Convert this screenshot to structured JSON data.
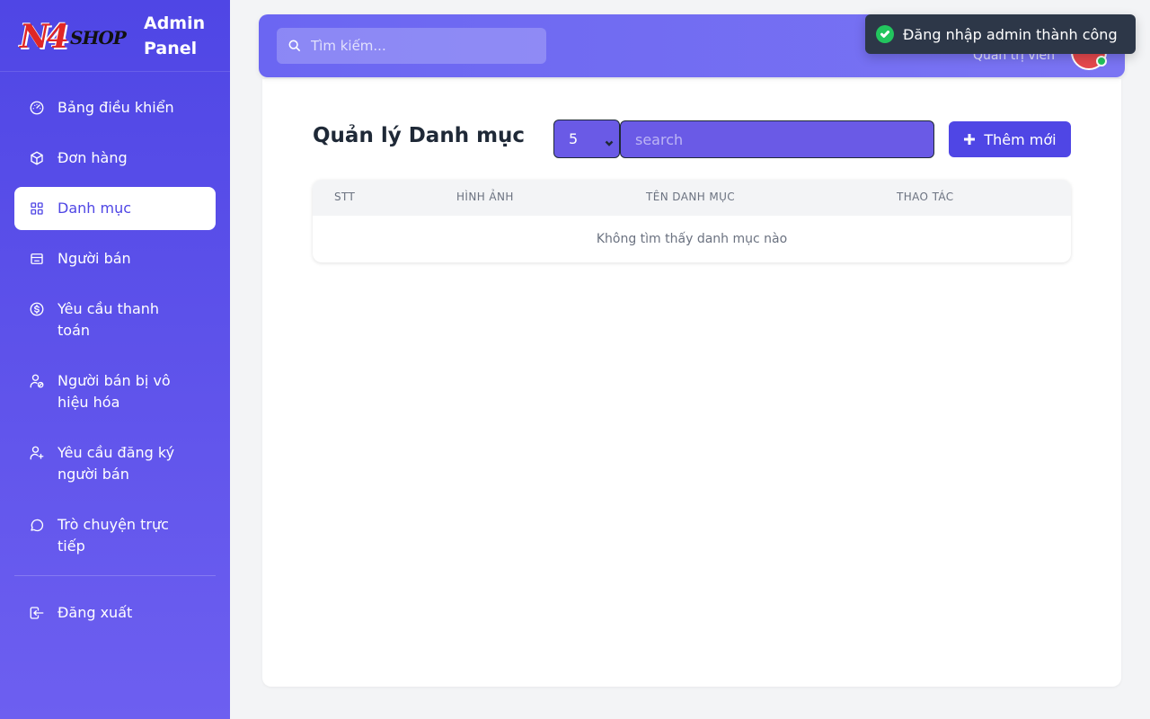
{
  "brand": {
    "logo_main": "N4",
    "logo_sub": "SHOP",
    "title": "Admin Panel"
  },
  "sidebar": {
    "items": [
      {
        "label": "Bảng điều khiển",
        "icon": "gauge-icon"
      },
      {
        "label": "Đơn hàng",
        "icon": "box-icon"
      },
      {
        "label": "Danh mục",
        "icon": "grid-icon",
        "active": true
      },
      {
        "label": "Người bán",
        "icon": "store-icon"
      },
      {
        "label": "Yêu cầu thanh toán",
        "icon": "dollar-icon"
      },
      {
        "label": "Người bán bị vô hiệu hóa",
        "icon": "user-block-icon"
      },
      {
        "label": "Yêu cầu đăng ký người bán",
        "icon": "user-plus-icon"
      },
      {
        "label": "Trò chuyện trực tiếp",
        "icon": "chat-icon"
      }
    ],
    "logout": {
      "label": "Đăng xuất",
      "icon": "logout-icon"
    }
  },
  "header": {
    "search_placeholder": "Tìm kiếm...",
    "role": "Quản trị viên"
  },
  "toast": {
    "message": "Đăng nhập admin thành công"
  },
  "main": {
    "title": "Quản lý Danh mục",
    "per_page": "5",
    "filter_placeholder": "search",
    "add_label": "Thêm mới",
    "columns": [
      "STT",
      "HÌNH ẢNH",
      "TÊN DANH MỤC",
      "THAO TÁC"
    ],
    "empty_message": "Không tìm thấy danh mục nào"
  },
  "colors": {
    "primary": "#4f46e5",
    "sidebar_bottom": "#6d5ff0",
    "success": "#22c55e",
    "toast_bg": "#2d3748"
  }
}
